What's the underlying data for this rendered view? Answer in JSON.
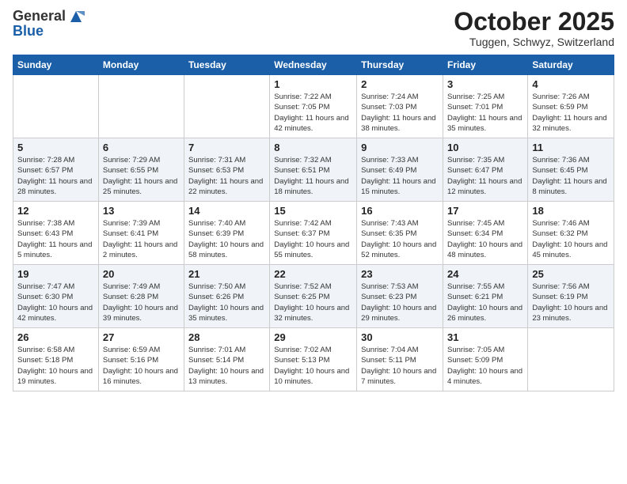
{
  "header": {
    "logo_general": "General",
    "logo_blue": "Blue",
    "month": "October 2025",
    "location": "Tuggen, Schwyz, Switzerland"
  },
  "days_of_week": [
    "Sunday",
    "Monday",
    "Tuesday",
    "Wednesday",
    "Thursday",
    "Friday",
    "Saturday"
  ],
  "weeks": [
    [
      {
        "day": "",
        "info": ""
      },
      {
        "day": "",
        "info": ""
      },
      {
        "day": "",
        "info": ""
      },
      {
        "day": "1",
        "info": "Sunrise: 7:22 AM\nSunset: 7:05 PM\nDaylight: 11 hours and 42 minutes."
      },
      {
        "day": "2",
        "info": "Sunrise: 7:24 AM\nSunset: 7:03 PM\nDaylight: 11 hours and 38 minutes."
      },
      {
        "day": "3",
        "info": "Sunrise: 7:25 AM\nSunset: 7:01 PM\nDaylight: 11 hours and 35 minutes."
      },
      {
        "day": "4",
        "info": "Sunrise: 7:26 AM\nSunset: 6:59 PM\nDaylight: 11 hours and 32 minutes."
      }
    ],
    [
      {
        "day": "5",
        "info": "Sunrise: 7:28 AM\nSunset: 6:57 PM\nDaylight: 11 hours and 28 minutes."
      },
      {
        "day": "6",
        "info": "Sunrise: 7:29 AM\nSunset: 6:55 PM\nDaylight: 11 hours and 25 minutes."
      },
      {
        "day": "7",
        "info": "Sunrise: 7:31 AM\nSunset: 6:53 PM\nDaylight: 11 hours and 22 minutes."
      },
      {
        "day": "8",
        "info": "Sunrise: 7:32 AM\nSunset: 6:51 PM\nDaylight: 11 hours and 18 minutes."
      },
      {
        "day": "9",
        "info": "Sunrise: 7:33 AM\nSunset: 6:49 PM\nDaylight: 11 hours and 15 minutes."
      },
      {
        "day": "10",
        "info": "Sunrise: 7:35 AM\nSunset: 6:47 PM\nDaylight: 11 hours and 12 minutes."
      },
      {
        "day": "11",
        "info": "Sunrise: 7:36 AM\nSunset: 6:45 PM\nDaylight: 11 hours and 8 minutes."
      }
    ],
    [
      {
        "day": "12",
        "info": "Sunrise: 7:38 AM\nSunset: 6:43 PM\nDaylight: 11 hours and 5 minutes."
      },
      {
        "day": "13",
        "info": "Sunrise: 7:39 AM\nSunset: 6:41 PM\nDaylight: 11 hours and 2 minutes."
      },
      {
        "day": "14",
        "info": "Sunrise: 7:40 AM\nSunset: 6:39 PM\nDaylight: 10 hours and 58 minutes."
      },
      {
        "day": "15",
        "info": "Sunrise: 7:42 AM\nSunset: 6:37 PM\nDaylight: 10 hours and 55 minutes."
      },
      {
        "day": "16",
        "info": "Sunrise: 7:43 AM\nSunset: 6:35 PM\nDaylight: 10 hours and 52 minutes."
      },
      {
        "day": "17",
        "info": "Sunrise: 7:45 AM\nSunset: 6:34 PM\nDaylight: 10 hours and 48 minutes."
      },
      {
        "day": "18",
        "info": "Sunrise: 7:46 AM\nSunset: 6:32 PM\nDaylight: 10 hours and 45 minutes."
      }
    ],
    [
      {
        "day": "19",
        "info": "Sunrise: 7:47 AM\nSunset: 6:30 PM\nDaylight: 10 hours and 42 minutes."
      },
      {
        "day": "20",
        "info": "Sunrise: 7:49 AM\nSunset: 6:28 PM\nDaylight: 10 hours and 39 minutes."
      },
      {
        "day": "21",
        "info": "Sunrise: 7:50 AM\nSunset: 6:26 PM\nDaylight: 10 hours and 35 minutes."
      },
      {
        "day": "22",
        "info": "Sunrise: 7:52 AM\nSunset: 6:25 PM\nDaylight: 10 hours and 32 minutes."
      },
      {
        "day": "23",
        "info": "Sunrise: 7:53 AM\nSunset: 6:23 PM\nDaylight: 10 hours and 29 minutes."
      },
      {
        "day": "24",
        "info": "Sunrise: 7:55 AM\nSunset: 6:21 PM\nDaylight: 10 hours and 26 minutes."
      },
      {
        "day": "25",
        "info": "Sunrise: 7:56 AM\nSunset: 6:19 PM\nDaylight: 10 hours and 23 minutes."
      }
    ],
    [
      {
        "day": "26",
        "info": "Sunrise: 6:58 AM\nSunset: 5:18 PM\nDaylight: 10 hours and 19 minutes."
      },
      {
        "day": "27",
        "info": "Sunrise: 6:59 AM\nSunset: 5:16 PM\nDaylight: 10 hours and 16 minutes."
      },
      {
        "day": "28",
        "info": "Sunrise: 7:01 AM\nSunset: 5:14 PM\nDaylight: 10 hours and 13 minutes."
      },
      {
        "day": "29",
        "info": "Sunrise: 7:02 AM\nSunset: 5:13 PM\nDaylight: 10 hours and 10 minutes."
      },
      {
        "day": "30",
        "info": "Sunrise: 7:04 AM\nSunset: 5:11 PM\nDaylight: 10 hours and 7 minutes."
      },
      {
        "day": "31",
        "info": "Sunrise: 7:05 AM\nSunset: 5:09 PM\nDaylight: 10 hours and 4 minutes."
      },
      {
        "day": "",
        "info": ""
      }
    ]
  ]
}
